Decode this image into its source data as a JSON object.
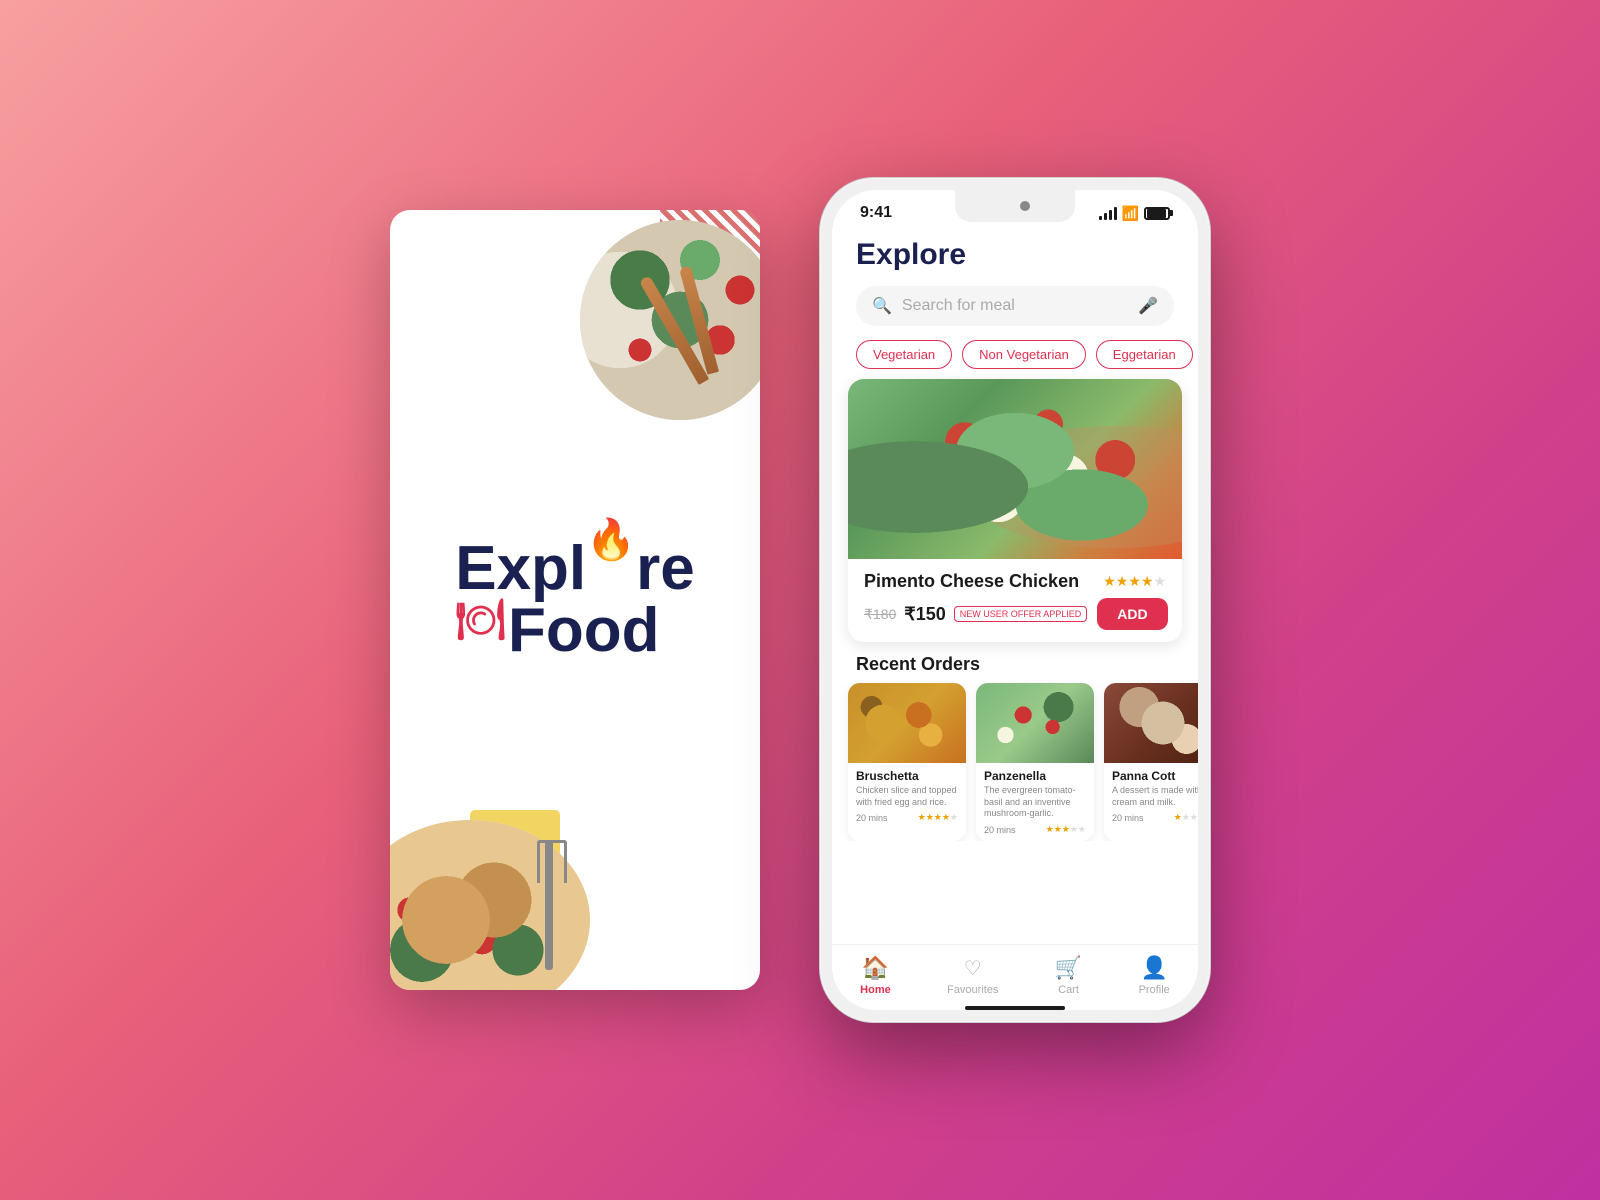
{
  "background": {
    "gradient": "linear-gradient(135deg, #f8a0a0 0%, #e8607a 40%, #d0408a 70%, #c030a0 100%)"
  },
  "splash": {
    "title_line1": "Expl",
    "title_line1b": "re",
    "title_line2": "Food",
    "logo_icon": "🔥",
    "cloche_icon": "🍽"
  },
  "phone": {
    "status": {
      "time": "9:41",
      "signal_bars": 4,
      "battery_percent": 85
    },
    "header": {
      "title": "Explore"
    },
    "search": {
      "placeholder": "Search for meal"
    },
    "filters": [
      "Vegetarian",
      "Non Vegetarian",
      "Eggetarian"
    ],
    "featured": {
      "name": "Pimento Cheese Chicken",
      "rating": 4,
      "max_rating": 5,
      "price_original": "₹180",
      "price_current": "₹150",
      "offer_label": "NEW USER OFFER APPLIED",
      "add_button": "ADD"
    },
    "recent_orders": {
      "section_title": "Recent Orders",
      "items": [
        {
          "name": "Bruschetta",
          "description": "Chicken slice and topped with fried egg and rice.",
          "time": "20 mins",
          "rating": 4,
          "type": "bruschetta"
        },
        {
          "name": "Panzenella",
          "description": "The evergreen tomato-basil and an inventive mushroom-garlic.",
          "time": "20 mins",
          "rating": 3,
          "type": "panzenella"
        },
        {
          "name": "Panna Cott",
          "description": "A dessert is made with cream and milk.",
          "time": "20 mins",
          "rating": 1,
          "type": "pannacotta"
        }
      ]
    },
    "nav": {
      "items": [
        {
          "label": "Home",
          "icon": "🏠",
          "active": true
        },
        {
          "label": "Favourites",
          "icon": "🤍",
          "active": false
        },
        {
          "label": "Cart",
          "icon": "🛒",
          "active": false
        },
        {
          "label": "Profile",
          "icon": "👤",
          "active": false
        }
      ]
    }
  }
}
